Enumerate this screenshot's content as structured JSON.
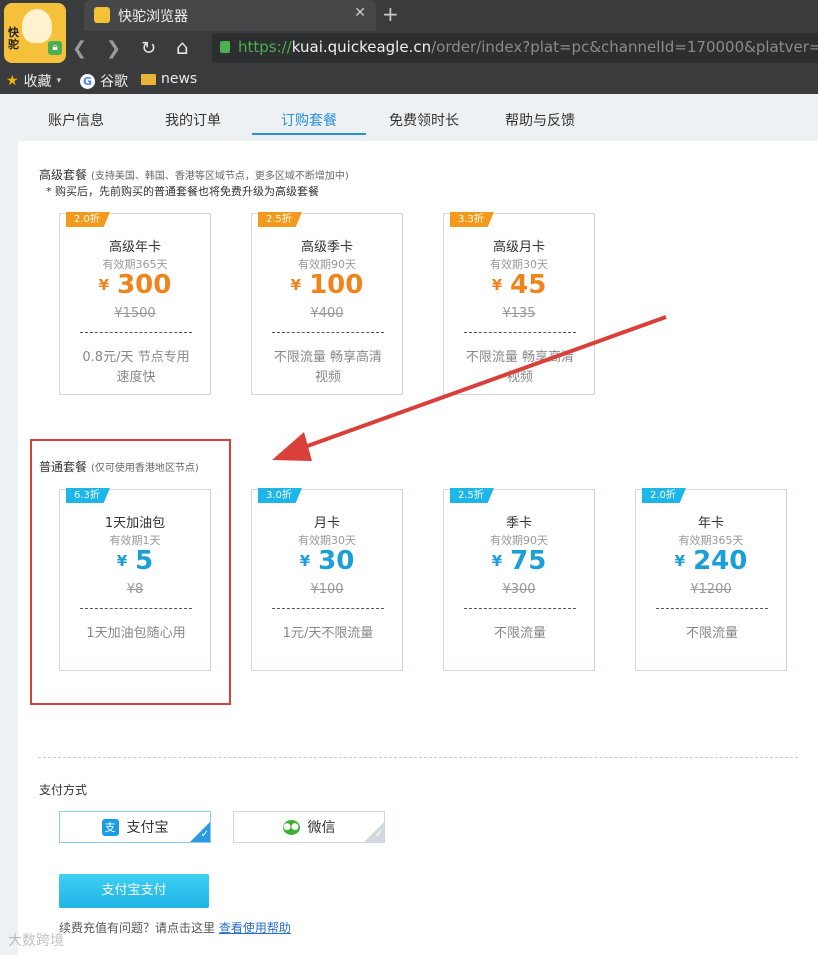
{
  "browser": {
    "logo_text": "快驼",
    "tab_title": "快驼浏览器",
    "tab_close": "✕",
    "new_tab": "+",
    "nav": {
      "back": "❮",
      "forward": "❯",
      "reload": "↻",
      "home": "⌂"
    },
    "url": {
      "scheme": "https://",
      "host": "kuai.quickeagle.cn",
      "path": "/order/index?plat=pc&channelId=170000&platver=10"
    },
    "bookmarks": [
      {
        "label": "收藏",
        "icon": "star-icon"
      },
      {
        "label": "谷歌",
        "icon": "google-icon"
      },
      {
        "label": "news",
        "icon": "folder-icon"
      }
    ]
  },
  "nav_tabs": [
    "账户信息",
    "我的订单",
    "订购套餐",
    "免费领时长",
    "帮助与反馈"
  ],
  "active_tab": "订购套餐",
  "premium": {
    "title": "高级套餐",
    "subtitle": "(支持美国、韩国、香港等区域节点，更多区域不断增加中)",
    "note": "* 购买后，先前购买的普通套餐也将免费升级为高级套餐",
    "plans": [
      {
        "badge": "2.0折",
        "name": "高级年卡",
        "validity": "有效期365天",
        "currency": "¥",
        "price": "300",
        "original": "¥1500",
        "desc": "0.8元/天 节点专用 速度快"
      },
      {
        "badge": "2.5折",
        "name": "高级季卡",
        "validity": "有效期90天",
        "currency": "¥",
        "price": "100",
        "original": "¥400",
        "desc": "不限流量 畅享高清视频"
      },
      {
        "badge": "3.3折",
        "name": "高级月卡",
        "validity": "有效期30天",
        "currency": "¥",
        "price": "45",
        "original": "¥135",
        "desc": "不限流量 畅享高清视频"
      }
    ]
  },
  "standard": {
    "title": "普通套餐",
    "subtitle": "(仅可使用香港地区节点)",
    "plans": [
      {
        "badge": "6.3折",
        "name": "1天加油包",
        "validity": "有效期1天",
        "currency": "¥",
        "price": "5",
        "original": "¥8",
        "desc": "1天加油包随心用"
      },
      {
        "badge": "3.0折",
        "name": "月卡",
        "validity": "有效期30天",
        "currency": "¥",
        "price": "30",
        "original": "¥100",
        "desc": "1元/天不限流量"
      },
      {
        "badge": "2.5折",
        "name": "季卡",
        "validity": "有效期90天",
        "currency": "¥",
        "price": "75",
        "original": "¥300",
        "desc": "不限流量"
      },
      {
        "badge": "2.0折",
        "name": "年卡",
        "validity": "有效期365天",
        "currency": "¥",
        "price": "240",
        "original": "¥1200",
        "desc": "不限流量"
      }
    ]
  },
  "payment": {
    "label": "支付方式",
    "options": [
      {
        "label": "支付宝",
        "icon": "alipay-icon",
        "selected": true
      },
      {
        "label": "微信",
        "icon": "wechat-icon",
        "selected": false
      }
    ],
    "pay_button": "支付宝支付",
    "help_text": "续费充值有问题？请点击这里",
    "help_link": "查看使用帮助"
  },
  "watermark": "大数跨境",
  "colors": {
    "orange": "#f0841c",
    "blue": "#1c9fd8",
    "accent": "#2a8fd8",
    "highlight_red": "#d9403a"
  }
}
